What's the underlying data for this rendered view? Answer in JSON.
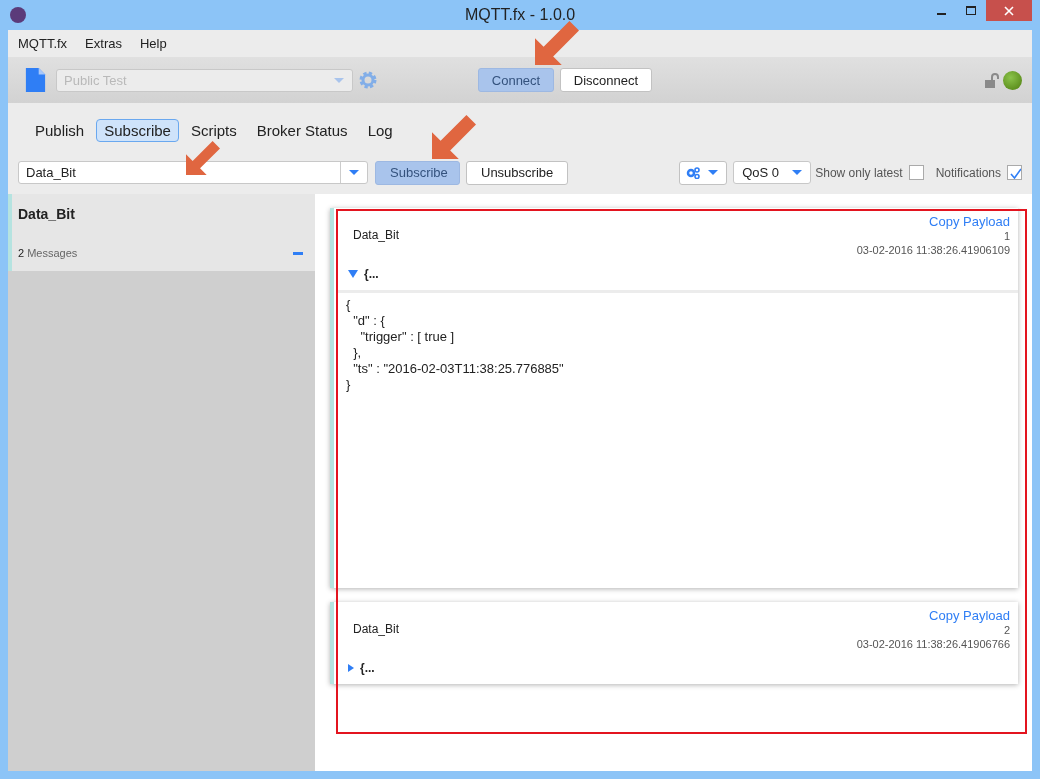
{
  "window": {
    "title": "MQTT.fx - 1.0.0"
  },
  "menu": [
    "MQTT.fx",
    "Extras",
    "Help"
  ],
  "toolbar": {
    "profile": {
      "value": "Public Test",
      "disabled": true
    },
    "buttons": [
      {
        "label": "Connect",
        "disabled": true
      },
      {
        "label": "Disconnect",
        "disabled": false
      }
    ]
  },
  "tabs": [
    {
      "label": "Publish",
      "selected": false
    },
    {
      "label": "Subscribe",
      "selected": true
    },
    {
      "label": "Scripts",
      "selected": false
    },
    {
      "label": "Broker Status",
      "selected": false
    },
    {
      "label": "Log",
      "selected": false
    }
  ],
  "subscribe_bar": {
    "topic": "Data_Bit",
    "buttons": [
      {
        "label": "Subscribe",
        "disabled": true
      },
      {
        "label": "Unsubscribe",
        "disabled": false
      }
    ],
    "qos": "QoS 0",
    "options": [
      {
        "label": "Show only latest",
        "checked": false
      },
      {
        "label": "Notifications",
        "checked": true
      }
    ]
  },
  "subscriptions": [
    {
      "topic": "Data_Bit",
      "count": "2",
      "count_label": "Messages"
    }
  ],
  "messages": [
    {
      "topic": "Data_Bit",
      "action": "Copy Payload",
      "number": "1",
      "timestamp": "03-02-2016  11:38:26.41906109",
      "summary": "{...",
      "expanded": true,
      "payload": [
        "{",
        "  \"d\" : {",
        "    \"trigger\" : [ true ]",
        "  },",
        "  \"ts\" : \"2016-02-03T11:38:25.776885\"",
        "}"
      ]
    },
    {
      "topic": "Data_Bit",
      "action": "Copy Payload",
      "number": "2",
      "timestamp": "03-02-2016  11:38:26.41906766",
      "summary": "{...",
      "expanded": false
    }
  ]
}
